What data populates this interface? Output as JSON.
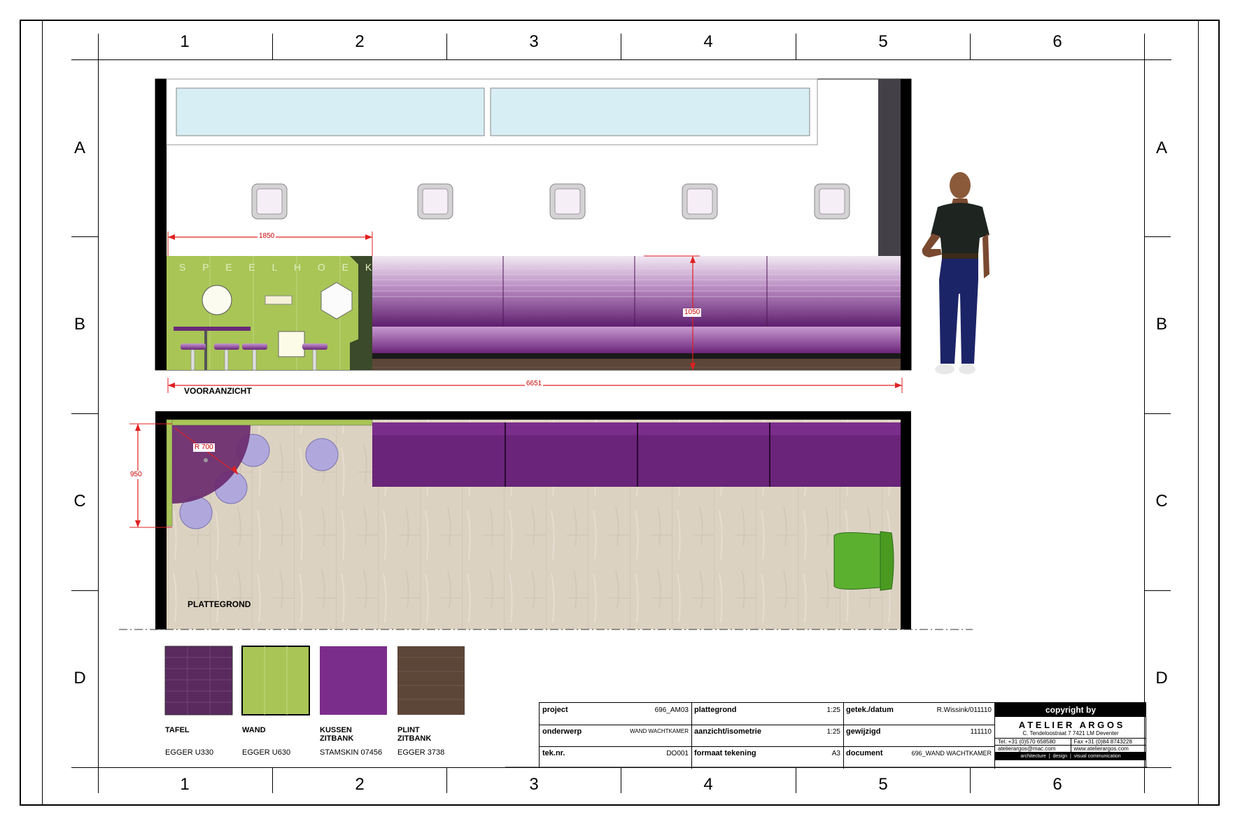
{
  "grid": {
    "columns": [
      "1",
      "2",
      "3",
      "4",
      "5",
      "6"
    ],
    "rows": [
      "A",
      "B",
      "C",
      "D"
    ]
  },
  "elevation": {
    "title": "VOORAANZICHT",
    "play_corner_text": "S P E E L H O E K",
    "dim_play_width": "1850",
    "dim_height": "1050",
    "dim_total_width": "6651"
  },
  "plan": {
    "title": "PLATTEGROND",
    "dim_radius": "R 700",
    "dim_depth": "950"
  },
  "materials": [
    {
      "name": "TAFEL",
      "code": "EGGER U330",
      "color": "#5a2a5e"
    },
    {
      "name": "WAND",
      "code": "EGGER U630",
      "color": "#a8c556"
    },
    {
      "name": "KUSSEN\nZITBANK",
      "code": "STAMSKIN 07456",
      "color": "#7b2d8c"
    },
    {
      "name": "PLINT\nZITBANK",
      "code": "EGGER 3738",
      "color": "#5c4638"
    }
  ],
  "title_block": {
    "project_label": "project",
    "project_value": "696_AM03",
    "plattegrond_label": "plattegrond",
    "plattegrond_value": "1:25",
    "getekend_label": "getek./datum",
    "getekend_value": "R.Wissink/011110",
    "onderwerp_label": "onderwerp",
    "onderwerp_value": "WAND WACHTKAMER",
    "aanzicht_label": "aanzicht/isometrie",
    "aanzicht_value": "1:25",
    "gewijzigd_label": "gewijzigd",
    "gewijzigd_value": "111110",
    "teknr_label": "tek.nr.",
    "teknr_value": "DO001",
    "formaat_label": "formaat tekening",
    "formaat_value": "A3",
    "document_label": "document",
    "document_value": "696_WAND WACHTKAMER"
  },
  "company": {
    "copyright": "copyright by",
    "name": "A T E L I E R   A R G O S",
    "address": "C. Tendeloostraat 7  7421 LM  Deventer",
    "tel": "Tel. +31 (0)570 658580",
    "fax": "Fax +31 (0)84 8743228",
    "email": "atelierargos@mac.com",
    "web": "www.atelierargos.com",
    "services": "architecture  |  design  |  visual communication"
  },
  "colors": {
    "purple": "#7a2a8a",
    "green": "#a8c556",
    "bright_green": "#5cb030",
    "floor": "#ddd3c4",
    "dim_red": "#e02020",
    "window": "#d8eef5"
  }
}
